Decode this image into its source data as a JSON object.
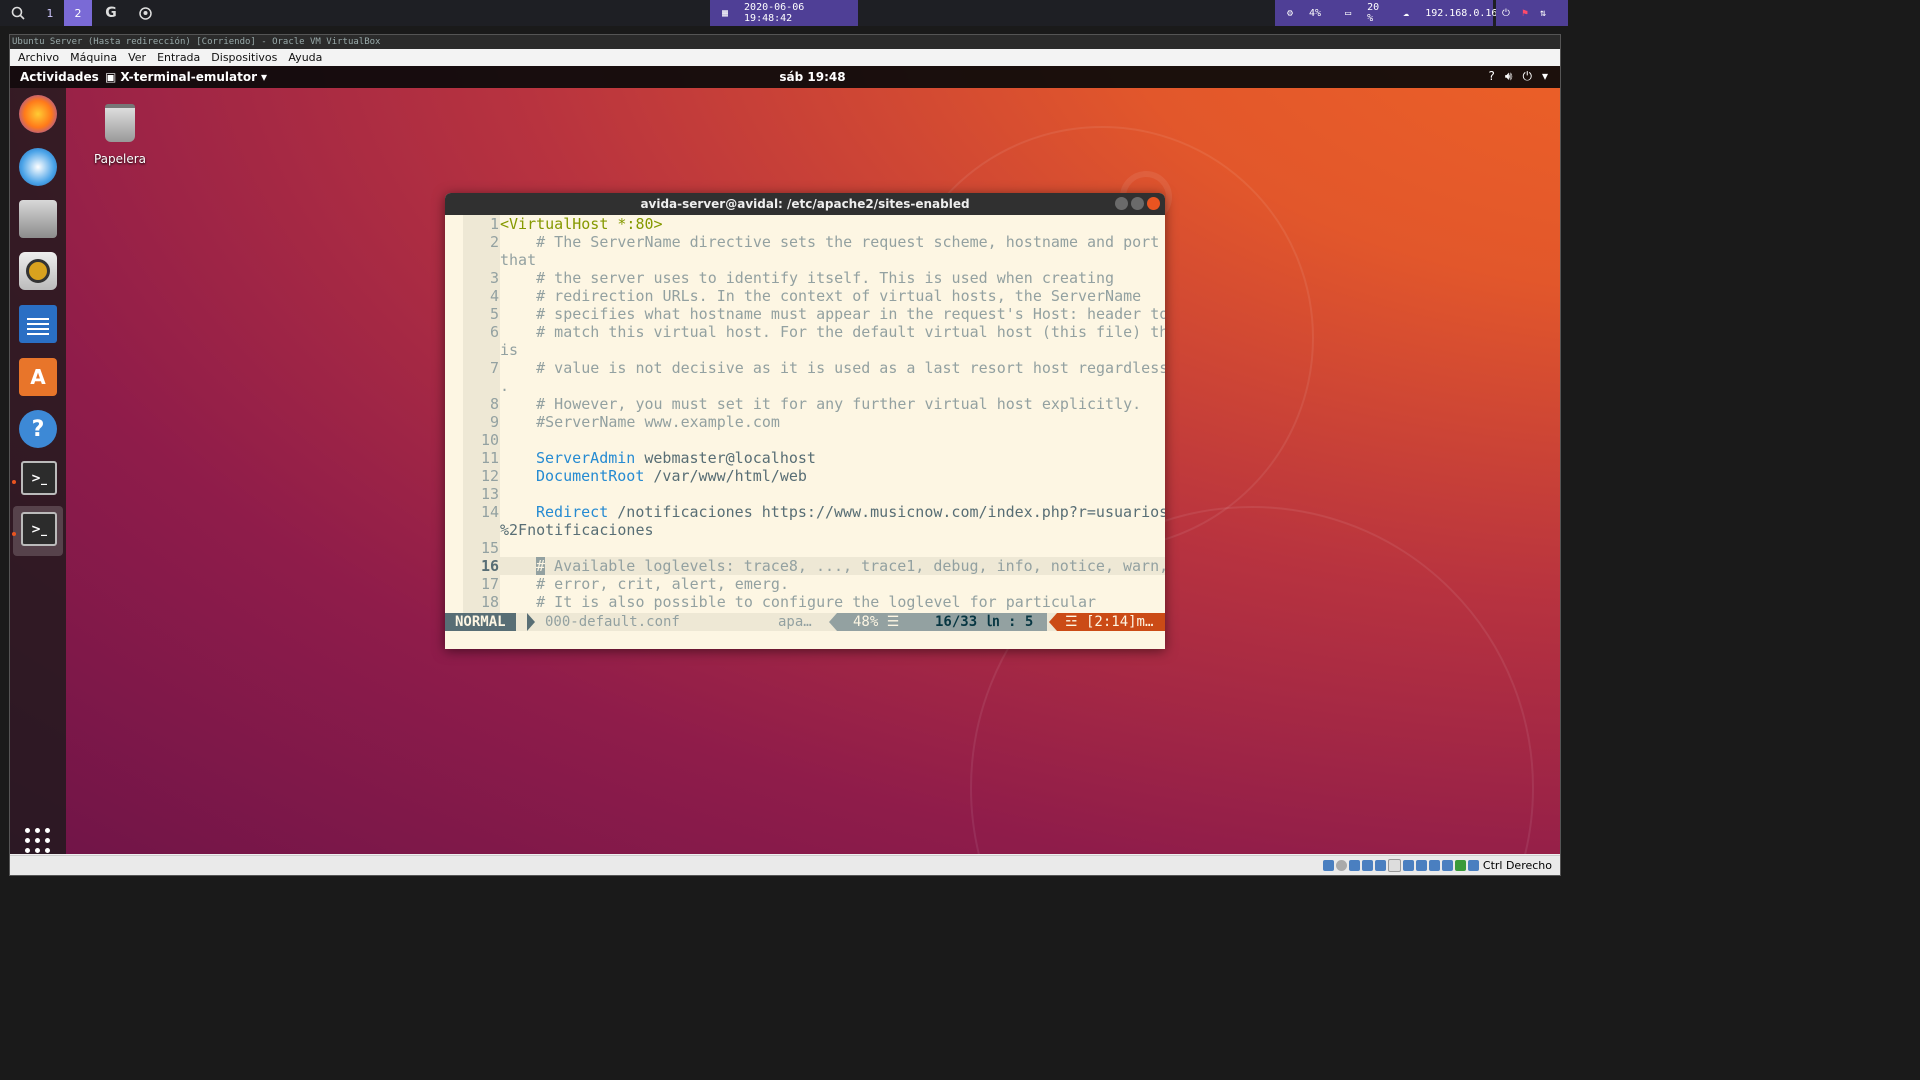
{
  "hostbar": {
    "workspaces": [
      "1",
      "2"
    ],
    "datetime": "2020-06-06 19:48:42",
    "cpu": "4%",
    "disk": "20 %",
    "ip": "192.168.0.16"
  },
  "vbox": {
    "title": "Ubuntu Server (Hasta redirección) [Corriendo] - Oracle VM VirtualBox",
    "menu": [
      "Archivo",
      "Máquina",
      "Ver",
      "Entrada",
      "Dispositivos",
      "Ayuda"
    ],
    "host_key": "Ctrl Derecho"
  },
  "gnome": {
    "activities": "Actividades",
    "app_name": "X-terminal-emulator",
    "clock": "sáb 19:48"
  },
  "desktop": {
    "trash_label": "Papelera"
  },
  "terminal": {
    "title": "avida-server@avidal: /etc/apache2/sites-enabled",
    "lines": [
      {
        "n": "1",
        "text": "<VirtualHost *:80>"
      },
      {
        "n": "2",
        "text": "    # The ServerName directive sets the request scheme, hostname and port"
      },
      {
        "n": "",
        "text": "that"
      },
      {
        "n": "3",
        "text": "    # the server uses to identify itself. This is used when creating"
      },
      {
        "n": "4",
        "text": "    # redirection URLs. In the context of virtual hosts, the ServerName"
      },
      {
        "n": "5",
        "text": "    # specifies what hostname must appear in the request's Host: header to"
      },
      {
        "n": "6",
        "text": "    # match this virtual host. For the default virtual host (this file) th"
      },
      {
        "n": "",
        "text": "is"
      },
      {
        "n": "7",
        "text": "    # value is not decisive as it is used as a last resort host regardless"
      },
      {
        "n": "",
        "text": "."
      },
      {
        "n": "8",
        "text": "    # However, you must set it for any further virtual host explicitly."
      },
      {
        "n": "9",
        "text": "    #ServerName www.example.com"
      },
      {
        "n": "10",
        "text": ""
      },
      {
        "n": "11",
        "kw": "ServerAdmin",
        "rest": " webmaster@localhost"
      },
      {
        "n": "12",
        "kw": "DocumentRoot",
        "rest": " /var/www/html/web"
      },
      {
        "n": "13",
        "text": ""
      },
      {
        "n": "14",
        "kw": "Redirect",
        "rest": " /notificaciones https://www.musicnow.com/index.php?r=usuarios"
      },
      {
        "n": "",
        "text": "%2Fnotificaciones"
      },
      {
        "n": "15",
        "text": ""
      },
      {
        "n": "16",
        "text": " Available loglevels: trace8, ..., trace1, debug, info, notice, warn,"
      },
      {
        "n": "17",
        "text": "    # error, crit, alert, emerg."
      },
      {
        "n": "18",
        "text": "    # It is also possible to configure the loglevel for particular"
      }
    ],
    "status": {
      "mode": "NORMAL",
      "file": "000-default.conf",
      "filetype": "apa…",
      "percent": "48% ☰",
      "position": "16/33 ㏑ :  5",
      "warning": "☲ [2:14]m…"
    }
  }
}
